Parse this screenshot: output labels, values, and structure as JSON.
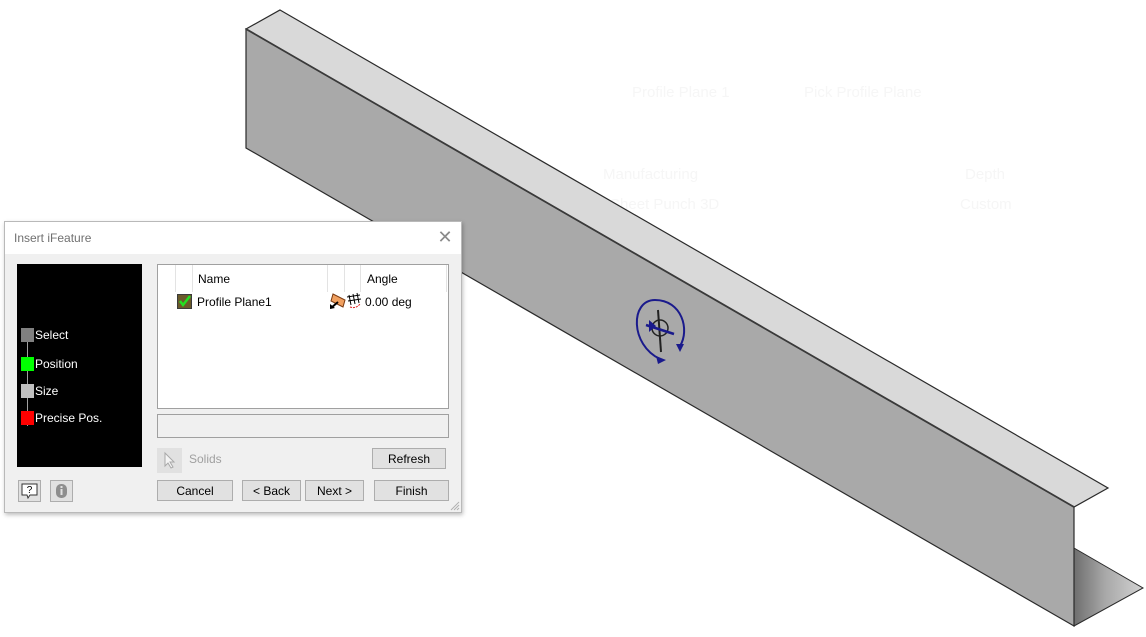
{
  "background_ghost_text": [
    "Profile Plane 1",
    "Pick Profile Plane",
    "Manufacturing",
    "Sheet Punch 3D",
    "Depth",
    "Custom"
  ],
  "viewport": {
    "model": "sheet metal C-channel",
    "colors": {
      "top_face": "#d9d9d9",
      "front_face": "#a9a9a9",
      "edge": "#2a2a2a",
      "gizmo": "#1a1a8c"
    }
  },
  "dialog": {
    "title": "Insert iFeature",
    "close_icon": "close-icon",
    "steps": [
      {
        "label": "Select",
        "color": "#808080"
      },
      {
        "label": "Position",
        "color": "#00ff00"
      },
      {
        "label": "Size",
        "color": "#c0c0c0"
      },
      {
        "label": "Precise Pos.",
        "color": "#ff0000"
      }
    ],
    "table": {
      "columns": [
        "Name",
        "Angle"
      ],
      "rows": [
        {
          "name": "Profile Plane1",
          "angle": "0.00 deg",
          "checked": true
        }
      ]
    },
    "status_text": "",
    "solids_label": "Solids",
    "buttons": {
      "refresh": "Refresh",
      "cancel": "Cancel",
      "back": "< Back",
      "next": "Next >",
      "finish": "Finish"
    }
  }
}
